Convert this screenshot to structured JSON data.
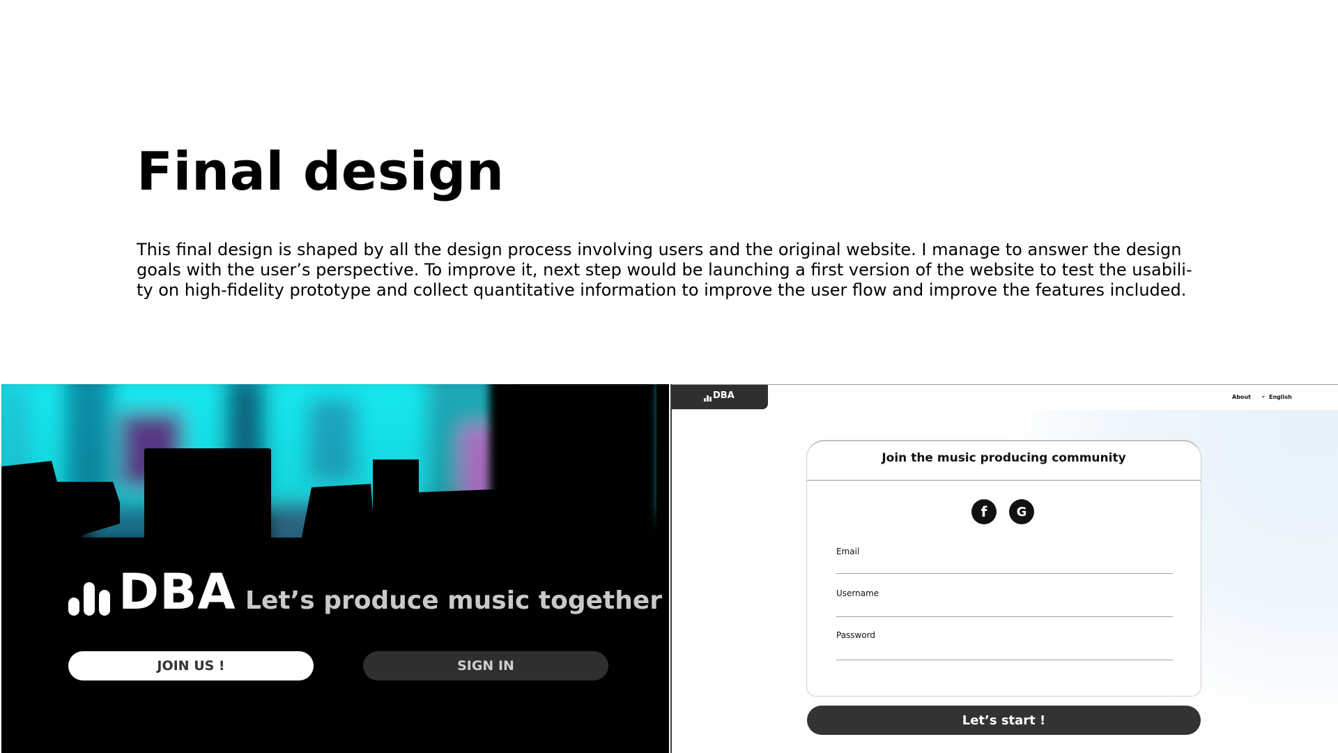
{
  "slide": {
    "title": "Final design",
    "description": "This final design is shaped by all the design process involving users and the original website. I manage to answer the design goals with the user’s perspective. To improve it, next step would be launching a first version of the website to test the usabili- ty on high-fidelity prototype and collect quantitative information to improve the user flow and improve the features included."
  },
  "landing": {
    "logo_text": "DBA",
    "tagline": "Let’s produce music together",
    "join_label": "JOIN US !",
    "signin_label": "SIGN IN"
  },
  "signup": {
    "brand": "DBA",
    "nav_about": "About",
    "nav_language": "English",
    "card_title": "Join the music producing community",
    "social_icons": [
      "facebook-icon",
      "google-icon"
    ],
    "fields": {
      "email_label": "Email",
      "username_label": "Username",
      "password_label": "Password"
    },
    "submit_label": "Let’s start !"
  },
  "colors": {
    "dark_button": "#2f2f2f",
    "accent_cyan": "#14e6ee",
    "background_tint": "#e7f2fb"
  }
}
